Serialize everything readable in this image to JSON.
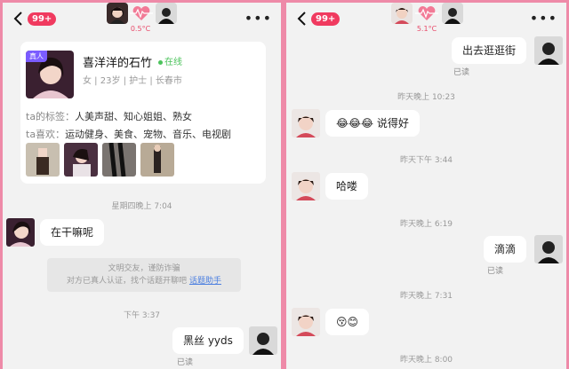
{
  "left": {
    "unread_badge": "99+",
    "temperature": "0.5°C",
    "profile": {
      "real_tag": "真人",
      "name": "喜洋洋的石竹",
      "online": "在线",
      "info": "女 | 23岁 | 护士 | 长春市",
      "tags_label": "ta的标签：",
      "tags": "人美声甜、知心姐姐、熟女",
      "likes_label": "ta喜欢：",
      "likes": "运动健身、美食、宠物、音乐、电视剧"
    },
    "time1": "星期四晚上 7:04",
    "msg1": "在干嘛呢",
    "notice_line1": "文明交友，谨防诈骗",
    "notice_line2": "对方已真人认证，找个话题开聊吧",
    "notice_link": "话题助手",
    "time2": "下午 3:37",
    "msg2": "黑丝 yyds",
    "read": "已读"
  },
  "right": {
    "unread_badge": "99+",
    "temperature": "5.1°C",
    "msg1": "出去逛逛街",
    "read1": "已读",
    "time1": "昨天晚上 10:23",
    "msg2": "😂😂😂 说得好",
    "time2": "昨天下午 3:44",
    "msg3": "哈喽",
    "time3": "昨天晚上 6:19",
    "msg4": "滴滴",
    "read2": "已读",
    "time4": "昨天晚上 7:31",
    "msg5": "😚😊",
    "time5": "昨天晚上 8:00"
  },
  "icons": {
    "back": "chevron-left-icon",
    "heart": "heartbeat-icon",
    "more": "more-dots-icon"
  },
  "colors": {
    "accent": "#f03a5f",
    "frame": "#ee8aa8",
    "online": "#4cc35c",
    "link": "#4a7ee0"
  }
}
